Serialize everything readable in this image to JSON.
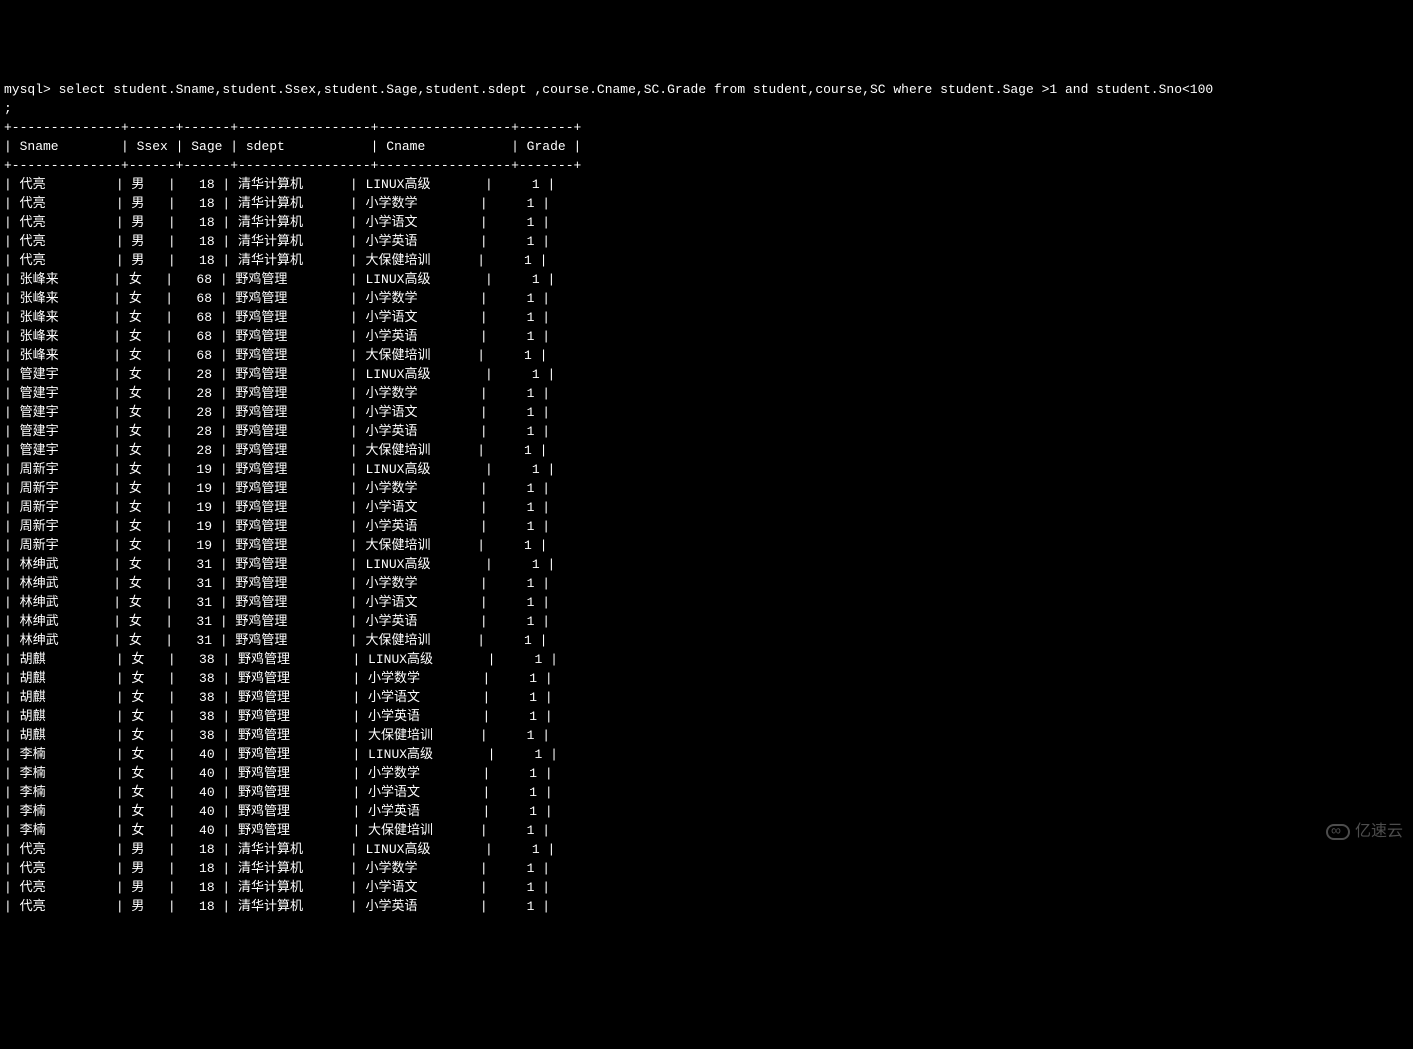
{
  "prompt": "mysql>",
  "query_line1": " select student.Sname,student.Ssex,student.Sage,student.sdept ,course.Cname,SC.Grade from student,course,SC where student.Sage >1 and student.Sno<100",
  "query_line2": ";",
  "columns": {
    "sname": "Sname",
    "ssex": "Ssex",
    "sage": "Sage",
    "sdept": "sdept",
    "cname": "Cname",
    "grade": "Grade"
  },
  "divider": "+--------------+------+------+-----------------+-----------------+-------+",
  "rows": [
    {
      "sname": "代亮",
      "ssex": "男",
      "sage": "18",
      "sdept": "清华计算机",
      "cname": "LINUX高级",
      "grade": "1"
    },
    {
      "sname": "代亮",
      "ssex": "男",
      "sage": "18",
      "sdept": "清华计算机",
      "cname": "小学数学",
      "grade": "1"
    },
    {
      "sname": "代亮",
      "ssex": "男",
      "sage": "18",
      "sdept": "清华计算机",
      "cname": "小学语文",
      "grade": "1"
    },
    {
      "sname": "代亮",
      "ssex": "男",
      "sage": "18",
      "sdept": "清华计算机",
      "cname": "小学英语",
      "grade": "1"
    },
    {
      "sname": "代亮",
      "ssex": "男",
      "sage": "18",
      "sdept": "清华计算机",
      "cname": "大保健培训",
      "grade": "1"
    },
    {
      "sname": "张峰来",
      "ssex": "女",
      "sage": "68",
      "sdept": "野鸡管理",
      "cname": "LINUX高级",
      "grade": "1"
    },
    {
      "sname": "张峰来",
      "ssex": "女",
      "sage": "68",
      "sdept": "野鸡管理",
      "cname": "小学数学",
      "grade": "1"
    },
    {
      "sname": "张峰来",
      "ssex": "女",
      "sage": "68",
      "sdept": "野鸡管理",
      "cname": "小学语文",
      "grade": "1"
    },
    {
      "sname": "张峰来",
      "ssex": "女",
      "sage": "68",
      "sdept": "野鸡管理",
      "cname": "小学英语",
      "grade": "1"
    },
    {
      "sname": "张峰来",
      "ssex": "女",
      "sage": "68",
      "sdept": "野鸡管理",
      "cname": "大保健培训",
      "grade": "1"
    },
    {
      "sname": "管建宇",
      "ssex": "女",
      "sage": "28",
      "sdept": "野鸡管理",
      "cname": "LINUX高级",
      "grade": "1"
    },
    {
      "sname": "管建宇",
      "ssex": "女",
      "sage": "28",
      "sdept": "野鸡管理",
      "cname": "小学数学",
      "grade": "1"
    },
    {
      "sname": "管建宇",
      "ssex": "女",
      "sage": "28",
      "sdept": "野鸡管理",
      "cname": "小学语文",
      "grade": "1"
    },
    {
      "sname": "管建宇",
      "ssex": "女",
      "sage": "28",
      "sdept": "野鸡管理",
      "cname": "小学英语",
      "grade": "1"
    },
    {
      "sname": "管建宇",
      "ssex": "女",
      "sage": "28",
      "sdept": "野鸡管理",
      "cname": "大保健培训",
      "grade": "1"
    },
    {
      "sname": "周新宇",
      "ssex": "女",
      "sage": "19",
      "sdept": "野鸡管理",
      "cname": "LINUX高级",
      "grade": "1"
    },
    {
      "sname": "周新宇",
      "ssex": "女",
      "sage": "19",
      "sdept": "野鸡管理",
      "cname": "小学数学",
      "grade": "1"
    },
    {
      "sname": "周新宇",
      "ssex": "女",
      "sage": "19",
      "sdept": "野鸡管理",
      "cname": "小学语文",
      "grade": "1"
    },
    {
      "sname": "周新宇",
      "ssex": "女",
      "sage": "19",
      "sdept": "野鸡管理",
      "cname": "小学英语",
      "grade": "1"
    },
    {
      "sname": "周新宇",
      "ssex": "女",
      "sage": "19",
      "sdept": "野鸡管理",
      "cname": "大保健培训",
      "grade": "1"
    },
    {
      "sname": "林绅武",
      "ssex": "女",
      "sage": "31",
      "sdept": "野鸡管理",
      "cname": "LINUX高级",
      "grade": "1"
    },
    {
      "sname": "林绅武",
      "ssex": "女",
      "sage": "31",
      "sdept": "野鸡管理",
      "cname": "小学数学",
      "grade": "1"
    },
    {
      "sname": "林绅武",
      "ssex": "女",
      "sage": "31",
      "sdept": "野鸡管理",
      "cname": "小学语文",
      "grade": "1"
    },
    {
      "sname": "林绅武",
      "ssex": "女",
      "sage": "31",
      "sdept": "野鸡管理",
      "cname": "小学英语",
      "grade": "1"
    },
    {
      "sname": "林绅武",
      "ssex": "女",
      "sage": "31",
      "sdept": "野鸡管理",
      "cname": "大保健培训",
      "grade": "1"
    },
    {
      "sname": "胡麒",
      "ssex": "女",
      "sage": "38",
      "sdept": "野鸡管理",
      "cname": "LINUX高级",
      "grade": "1"
    },
    {
      "sname": "胡麒",
      "ssex": "女",
      "sage": "38",
      "sdept": "野鸡管理",
      "cname": "小学数学",
      "grade": "1"
    },
    {
      "sname": "胡麒",
      "ssex": "女",
      "sage": "38",
      "sdept": "野鸡管理",
      "cname": "小学语文",
      "grade": "1"
    },
    {
      "sname": "胡麒",
      "ssex": "女",
      "sage": "38",
      "sdept": "野鸡管理",
      "cname": "小学英语",
      "grade": "1"
    },
    {
      "sname": "胡麒",
      "ssex": "女",
      "sage": "38",
      "sdept": "野鸡管理",
      "cname": "大保健培训",
      "grade": "1"
    },
    {
      "sname": "李楠",
      "ssex": "女",
      "sage": "40",
      "sdept": "野鸡管理",
      "cname": "LINUX高级",
      "grade": "1"
    },
    {
      "sname": "李楠",
      "ssex": "女",
      "sage": "40",
      "sdept": "野鸡管理",
      "cname": "小学数学",
      "grade": "1"
    },
    {
      "sname": "李楠",
      "ssex": "女",
      "sage": "40",
      "sdept": "野鸡管理",
      "cname": "小学语文",
      "grade": "1"
    },
    {
      "sname": "李楠",
      "ssex": "女",
      "sage": "40",
      "sdept": "野鸡管理",
      "cname": "小学英语",
      "grade": "1"
    },
    {
      "sname": "李楠",
      "ssex": "女",
      "sage": "40",
      "sdept": "野鸡管理",
      "cname": "大保健培训",
      "grade": "1"
    },
    {
      "sname": "代亮",
      "ssex": "男",
      "sage": "18",
      "sdept": "清华计算机",
      "cname": "LINUX高级",
      "grade": "1"
    },
    {
      "sname": "代亮",
      "ssex": "男",
      "sage": "18",
      "sdept": "清华计算机",
      "cname": "小学数学",
      "grade": "1"
    },
    {
      "sname": "代亮",
      "ssex": "男",
      "sage": "18",
      "sdept": "清华计算机",
      "cname": "小学语文",
      "grade": "1"
    },
    {
      "sname": "代亮",
      "ssex": "男",
      "sage": "18",
      "sdept": "清华计算机",
      "cname": "小学英语",
      "grade": "1"
    }
  ],
  "watermark": "亿速云"
}
